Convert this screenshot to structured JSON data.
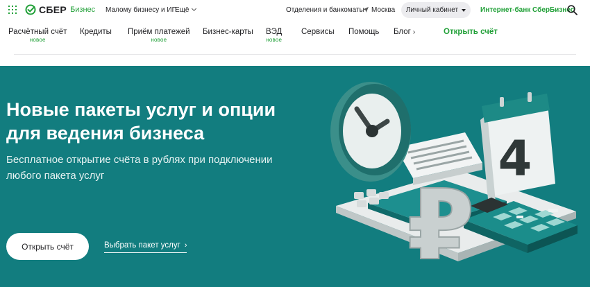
{
  "header": {
    "logo_text": "СБЕР",
    "logo_sub": "Бизнес",
    "small_business": "Малому бизнесу и ИП",
    "more": "Ещё",
    "branches": "Отделения и банкоматы",
    "city": "Москва",
    "cabinet": "Личный кабинет",
    "internet_bank": "Интернет-банк СберБизнес"
  },
  "nav": {
    "items": [
      {
        "label": "Расчётный счёт",
        "badge": "новое"
      },
      {
        "label": "Кредиты"
      },
      {
        "label": "Приём платежей",
        "badge": "новое"
      },
      {
        "label": "Бизнес-карты"
      },
      {
        "label": "ВЭД",
        "badge": "новое"
      },
      {
        "label": "Сервисы"
      },
      {
        "label": "Помощь"
      },
      {
        "label": "Блог"
      }
    ],
    "cta": "Открыть счёт"
  },
  "hero": {
    "title": "Новые пакеты услуг и опции для ведения бизнеса",
    "subtitle": "Бесплатное открытие счёта в рублях при подключении любого пакета услуг",
    "primary_button": "Открыть счёт",
    "secondary_link": "Выбрать пакет услуг",
    "calendar_number": "4",
    "currency_symbol": "₽"
  },
  "colors": {
    "brand_green": "#21a038",
    "hero_bg": "#127d7f"
  }
}
